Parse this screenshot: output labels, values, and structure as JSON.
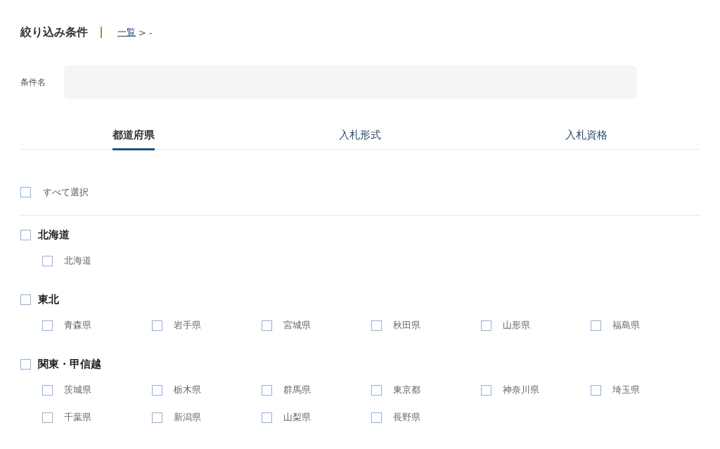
{
  "header": {
    "title": "絞り込み条件",
    "breadcrumb_link": "一覧",
    "breadcrumb_rest": "> -"
  },
  "condition_name": {
    "label": "条件名"
  },
  "tabs": [
    {
      "label": "都道府県",
      "selected": true
    },
    {
      "label": "入札形式",
      "selected": false
    },
    {
      "label": "入札資格",
      "selected": false
    }
  ],
  "select_all": {
    "label": "すべて選択",
    "checked": false
  },
  "regions": [
    {
      "name": "北海道",
      "checked": false,
      "prefectures": [
        {
          "name": "北海道",
          "checked": false
        }
      ]
    },
    {
      "name": "東北",
      "checked": false,
      "prefectures": [
        {
          "name": "青森県",
          "checked": false
        },
        {
          "name": "岩手県",
          "checked": false
        },
        {
          "name": "宮城県",
          "checked": false
        },
        {
          "name": "秋田県",
          "checked": false
        },
        {
          "name": "山形県",
          "checked": false
        },
        {
          "name": "福島県",
          "checked": false
        }
      ]
    },
    {
      "name": "関東・甲信越",
      "checked": false,
      "prefectures": [
        {
          "name": "茨城県",
          "checked": false
        },
        {
          "name": "栃木県",
          "checked": false
        },
        {
          "name": "群馬県",
          "checked": false
        },
        {
          "name": "東京都",
          "checked": false
        },
        {
          "name": "神奈川県",
          "checked": false
        },
        {
          "name": "埼玉県",
          "checked": false
        },
        {
          "name": "千葉県",
          "checked": false
        },
        {
          "name": "新潟県",
          "checked": false
        },
        {
          "name": "山梨県",
          "checked": false
        },
        {
          "name": "長野県",
          "checked": false
        }
      ]
    }
  ]
}
